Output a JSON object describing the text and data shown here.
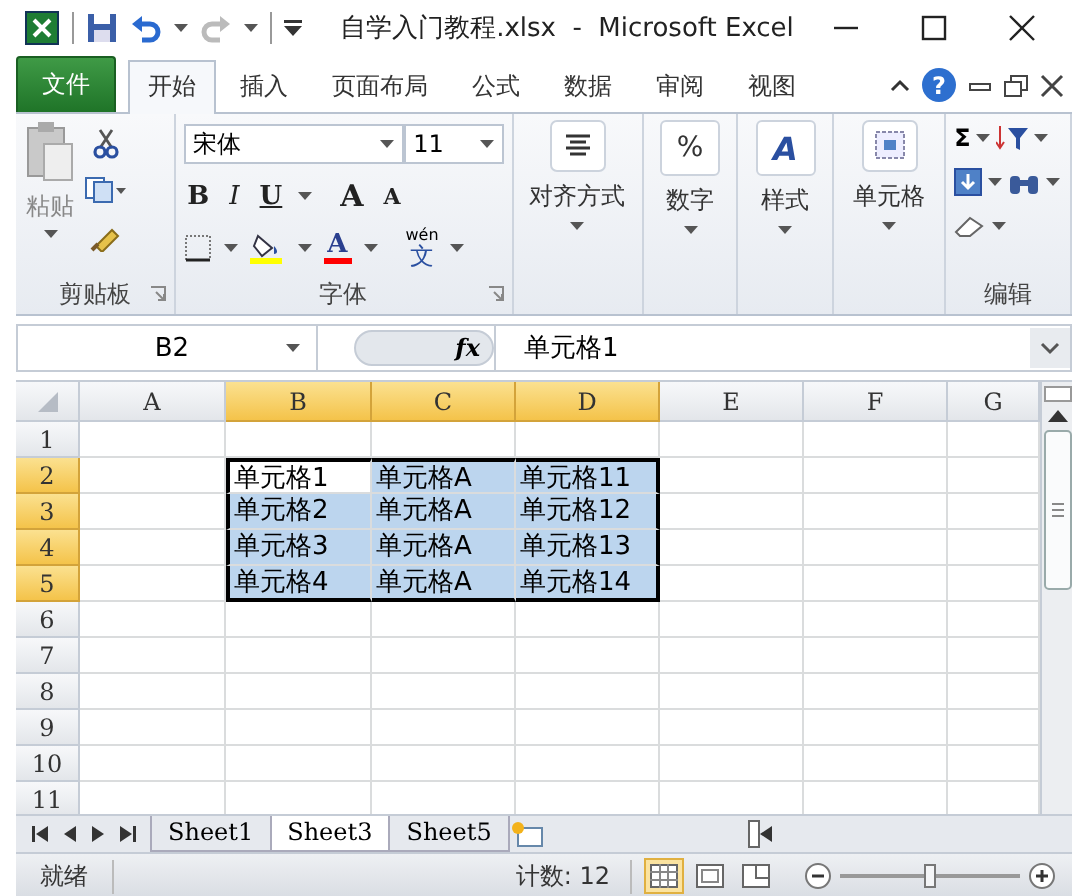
{
  "title_bar": {
    "title": "自学入门教程.xlsx  -  Microsoft Excel",
    "redo_disabled": true
  },
  "ribbon_tabs": [
    {
      "label": "文件",
      "kind": "file",
      "selected": false
    },
    {
      "label": "开始",
      "kind": "tab",
      "selected": true
    },
    {
      "label": "插入",
      "kind": "tab",
      "selected": false
    },
    {
      "label": "页面布局",
      "kind": "tab",
      "selected": false
    },
    {
      "label": "公式",
      "kind": "tab",
      "selected": false
    },
    {
      "label": "数据",
      "kind": "tab",
      "selected": false
    },
    {
      "label": "审阅",
      "kind": "tab",
      "selected": false
    },
    {
      "label": "视图",
      "kind": "tab",
      "selected": false
    }
  ],
  "help": "?",
  "clipboard": {
    "paste": "粘贴",
    "label": "剪贴板"
  },
  "font": {
    "name": "宋体",
    "size": "11",
    "label": "字体",
    "buttons": [
      {
        "kind": "bold",
        "label": "B"
      },
      {
        "kind": "italic",
        "label": "I"
      },
      {
        "kind": "underline",
        "label": "U"
      },
      {
        "kind": "grow",
        "label": "A"
      },
      {
        "kind": "shrink",
        "label": "A"
      }
    ],
    "font_color": "A",
    "phonetic": {
      "ruby": "wén",
      "glyph": "文"
    }
  },
  "big_buttons": [
    {
      "kind": "align",
      "label": "对齐方式"
    },
    {
      "kind": "number",
      "glyph": "%",
      "label": "数字"
    },
    {
      "kind": "styles",
      "glyph": "A",
      "label": "样式"
    },
    {
      "kind": "cells",
      "label": "单元格"
    }
  ],
  "editing": {
    "sum": "Σ",
    "label": "编辑"
  },
  "formula_bar": {
    "name_box": "B2",
    "fx": "fx",
    "value": "单元格1"
  },
  "sheet": {
    "columns": [
      {
        "label": "A",
        "selected": false
      },
      {
        "label": "B",
        "selected": true
      },
      {
        "label": "C",
        "selected": true
      },
      {
        "label": "D",
        "selected": true
      },
      {
        "label": "E",
        "selected": false
      },
      {
        "label": "F",
        "selected": false
      },
      {
        "label": "G",
        "selected": false
      }
    ],
    "rows": [
      {
        "label": "1",
        "selected": false
      },
      {
        "label": "2",
        "selected": true,
        "cells": [
          null,
          {
            "text": "单元格1",
            "selected": true,
            "active": true
          },
          {
            "text": "单元格A",
            "selected": true,
            "active": false
          },
          {
            "text": "单元格11",
            "selected": true,
            "active": false
          }
        ]
      },
      {
        "label": "3",
        "selected": true,
        "cells": [
          null,
          {
            "text": "单元格2",
            "selected": true,
            "active": false
          },
          {
            "text": "单元格A",
            "selected": true,
            "active": false
          },
          {
            "text": "单元格12",
            "selected": true,
            "active": false
          }
        ]
      },
      {
        "label": "4",
        "selected": true,
        "cells": [
          null,
          {
            "text": "单元格3",
            "selected": true,
            "active": false
          },
          {
            "text": "单元格A",
            "selected": true,
            "active": false
          },
          {
            "text": "单元格13",
            "selected": true,
            "active": false
          }
        ]
      },
      {
        "label": "5",
        "selected": true,
        "cells": [
          null,
          {
            "text": "单元格4",
            "selected": true,
            "active": false
          },
          {
            "text": "单元格A",
            "selected": true,
            "active": false
          },
          {
            "text": "单元格14",
            "selected": true,
            "active": false
          }
        ]
      },
      {
        "label": "6",
        "selected": false
      },
      {
        "label": "7",
        "selected": false
      },
      {
        "label": "8",
        "selected": false
      },
      {
        "label": "9",
        "selected": false
      },
      {
        "label": "10",
        "selected": false
      },
      {
        "label": "11",
        "selected": false
      }
    ]
  },
  "sheet_tabs": [
    {
      "label": "Sheet1",
      "selected": false
    },
    {
      "label": "Sheet3",
      "selected": true
    },
    {
      "label": "Sheet5",
      "selected": false
    }
  ],
  "status_bar": {
    "ready": "就绪",
    "count": "计数: 12",
    "views": [
      {
        "kind": "normal",
        "selected": true
      },
      {
        "kind": "layout",
        "selected": false
      },
      {
        "kind": "break",
        "selected": false
      }
    ],
    "zoom": {
      "level": 0.5
    }
  }
}
